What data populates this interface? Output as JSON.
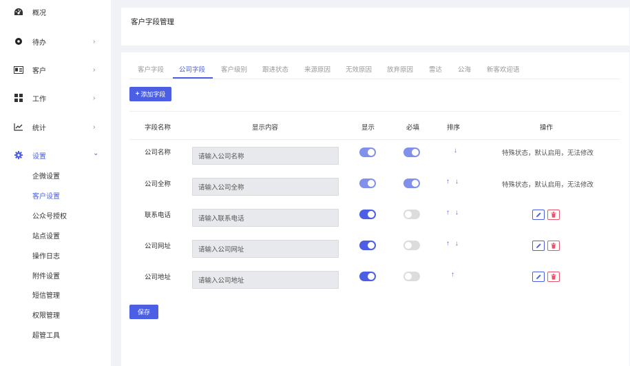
{
  "sidebar": {
    "items": [
      {
        "label": "概况",
        "icon": "dashboard-icon",
        "has_arrow": false
      },
      {
        "label": "待办",
        "icon": "circle-icon",
        "has_arrow": true
      },
      {
        "label": "客户",
        "icon": "contact-card-icon",
        "has_arrow": true
      },
      {
        "label": "工作",
        "icon": "grid-icon",
        "has_arrow": true
      },
      {
        "label": "统计",
        "icon": "trend-chart-icon",
        "has_arrow": true
      },
      {
        "label": "设置",
        "icon": "gear-icon",
        "has_arrow": true,
        "active": true,
        "expanded": true
      }
    ],
    "arrow_right": "›",
    "arrow_down": "⌄",
    "sub_items": [
      {
        "label": "企微设置"
      },
      {
        "label": "客户设置",
        "active": true
      },
      {
        "label": "公众号授权"
      },
      {
        "label": "站点设置"
      },
      {
        "label": "操作日志"
      },
      {
        "label": "附件设置"
      },
      {
        "label": "短信管理"
      },
      {
        "label": "权限管理"
      },
      {
        "label": "超管工具"
      }
    ]
  },
  "header": {
    "title": "客户字段管理"
  },
  "tabs": [
    {
      "label": "客户字段"
    },
    {
      "label": "公司字段",
      "active": true
    },
    {
      "label": "客户级别"
    },
    {
      "label": "跟进状态"
    },
    {
      "label": "来源原因"
    },
    {
      "label": "无效原因"
    },
    {
      "label": "放弃原因"
    },
    {
      "label": "雷达"
    },
    {
      "label": "公海"
    },
    {
      "label": "新客欢迎语"
    }
  ],
  "add_button": {
    "icon": "plus-icon",
    "label": "添加字段"
  },
  "table": {
    "columns": {
      "name": "字段名称",
      "content": "显示内容",
      "show": "显示",
      "required": "必填",
      "sort": "排序",
      "action": "操作"
    },
    "rows": [
      {
        "name": "公司名称",
        "placeholder": "请输入公司名称",
        "show": true,
        "required": true,
        "locked": true,
        "up": false,
        "down": true,
        "operation": "特殊状态，默认启用，无法修改"
      },
      {
        "name": "公司全称",
        "placeholder": "请输入公司全称",
        "show": true,
        "required": true,
        "locked": true,
        "up": true,
        "down": true,
        "operation": "特殊状态，默认启用，无法修改"
      },
      {
        "name": "联系电话",
        "placeholder": "请输入联系电话",
        "show": true,
        "required": false,
        "locked": false,
        "up": true,
        "down": true,
        "operation": ""
      },
      {
        "name": "公司网址",
        "placeholder": "请输入公司网址",
        "show": true,
        "required": false,
        "locked": false,
        "up": true,
        "down": true,
        "operation": ""
      },
      {
        "name": "公司地址",
        "placeholder": "请输入公司地址",
        "show": true,
        "required": false,
        "locked": false,
        "up": true,
        "down": false,
        "operation": ""
      }
    ],
    "arrow_up": "↑",
    "arrow_down": "↓"
  },
  "save_button": {
    "label": "保存"
  },
  "colors": {
    "primary": "#4b5ee4",
    "danger": "#e8556b",
    "toggle_off": "#dcdcdc"
  }
}
